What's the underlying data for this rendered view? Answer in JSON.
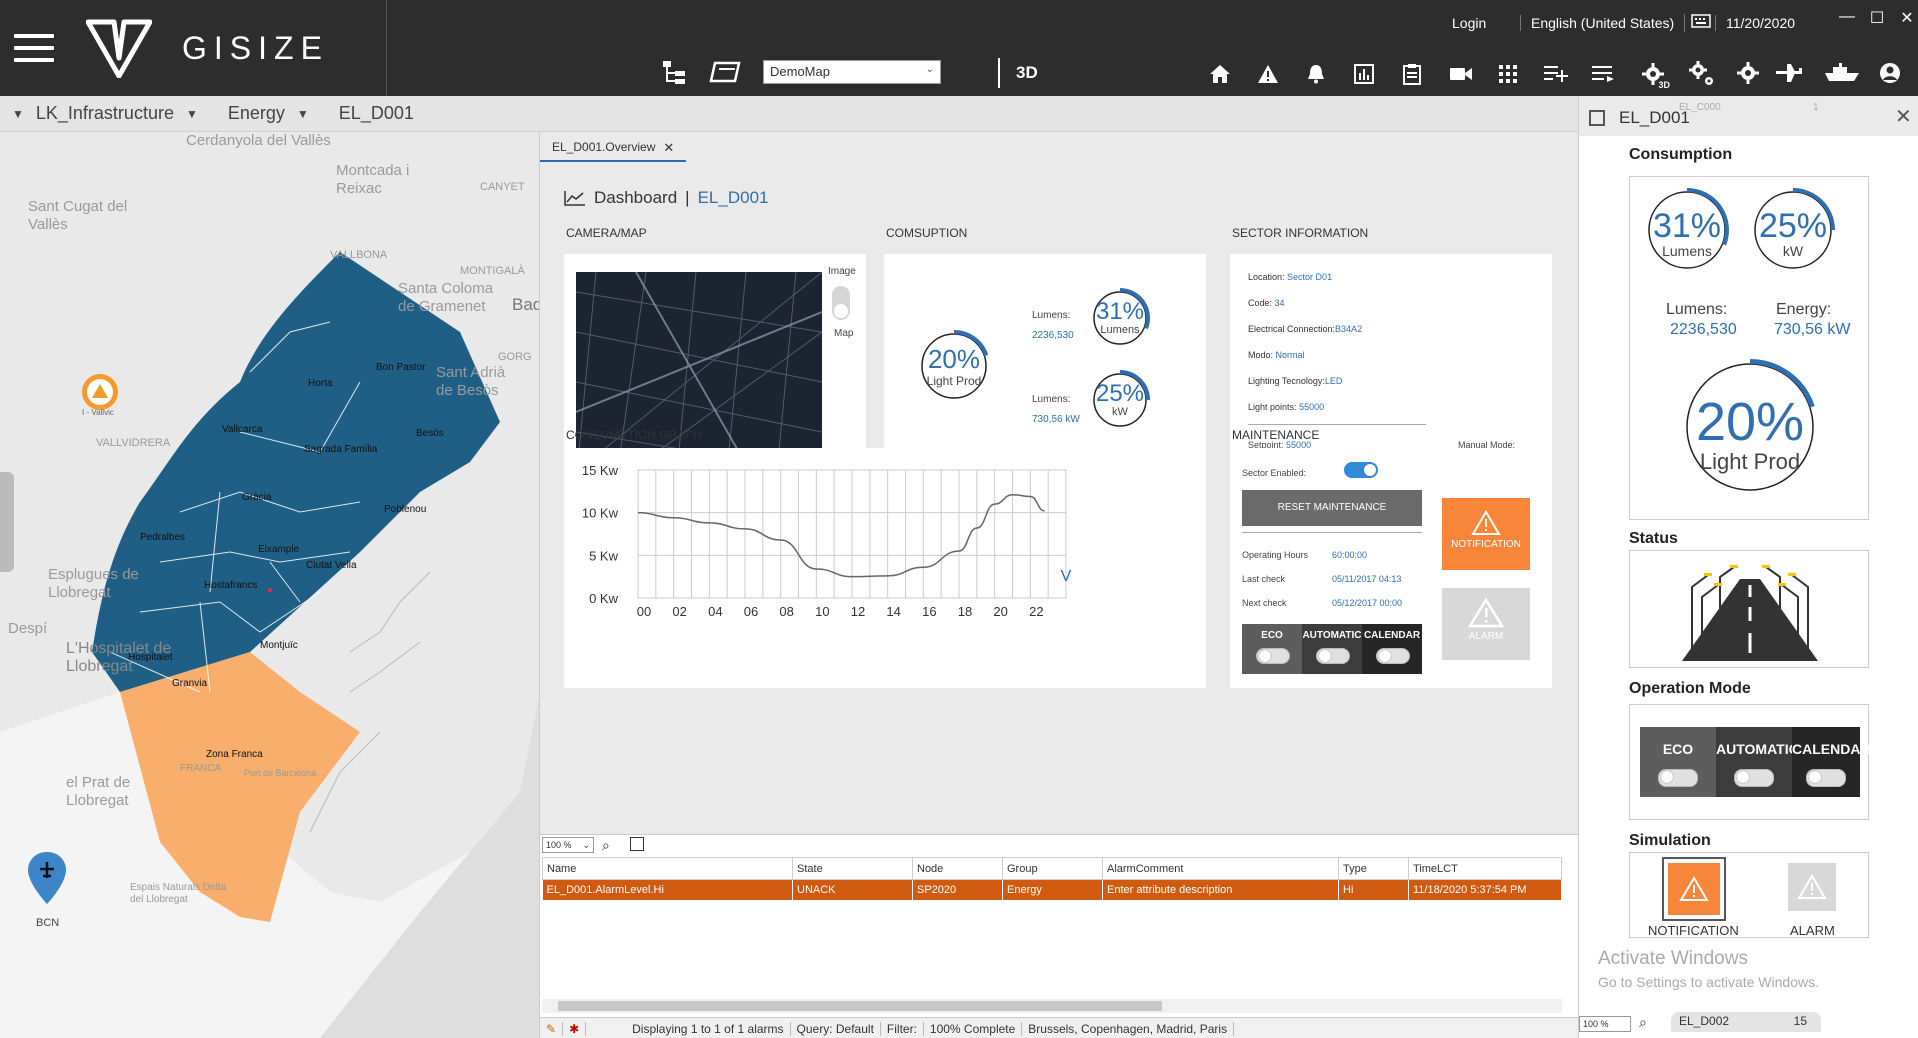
{
  "brand": "GISIZE",
  "topbar": {
    "map_select": "DemoMap",
    "btn_3d": "3D",
    "login": "Login",
    "language": "English (United States)",
    "date": "11/20/2020",
    "icon_3d_badge": "3D"
  },
  "breadcrumb": [
    "LK_Infrastructure",
    "Energy",
    "EL_D001"
  ],
  "map": {
    "labels": [
      "Cerdanyola del Vallès",
      "Montcada i Reixac",
      "CANYET",
      "Sant Cugat del Vallès",
      "VALLBONA",
      "MONTIGALÀ",
      "Santa Coloma de Gramenet",
      "Bad",
      "Sant Adrià de Besòs",
      "GORG",
      "Esplugues de Llobregat",
      "Despí",
      "L'Hospitalet de Llobregat",
      "el Prat de Llobregat",
      "Espais Naturals Delta del Llobregat",
      "VALLVIDRERA",
      "Zona Franca",
      "Port de Barcelona",
      "FRANCA",
      "BCN",
      "Vallvidrera"
    ],
    "districts": [
      "Horta",
      "Bon Pastor",
      "Vallcarca",
      "Sagrada Família",
      "Besòs",
      "Gràcia",
      "Poblenou",
      "Pedralbes",
      "Eixample",
      "Ciutat Vella",
      "Hostafrancs",
      "Montjuïc",
      "Hospitalet",
      "Granvia",
      "Zona Franca"
    ],
    "marker_label": "I - Vallvic",
    "district_color": "#1f5f86",
    "port_color": "#f9ae6c"
  },
  "tab": {
    "label": "EL_D001.Overview",
    "close": "✕"
  },
  "dashboard": {
    "title": "Dashboard",
    "subtitle": "EL_D001",
    "sections": {
      "camera": "CAMERA/MAP",
      "consumption": "COMSUPTION",
      "sector": "SECTOR INFORMATION",
      "graph": "CONSUMPTION GRAPH",
      "maintenance": "MAINTENANCE"
    },
    "camera": {
      "image_label": "Image",
      "map_label": "Map"
    },
    "gauges": {
      "main": {
        "value": "20%",
        "label": "Light Prod",
        "pct": 20
      },
      "lumens": {
        "value": "31%",
        "label": "Lumens",
        "pct": 31,
        "caption": "Lumens:",
        "reading": "2236,530"
      },
      "kw": {
        "value": "25%",
        "label": "kW",
        "pct": 25,
        "caption": "Lumens:",
        "reading": "730,56 kW"
      }
    },
    "sector": {
      "rows": [
        {
          "label": "Location:",
          "value": "Sector D01"
        },
        {
          "label": "Code:",
          "value": "34"
        },
        {
          "label": "Electrical Connection:",
          "value": "B34A2"
        },
        {
          "label": "Modo:",
          "value": "Normal"
        },
        {
          "label": "Lighting Tecnology:",
          "value": "LED"
        },
        {
          "label": "Light points:",
          "value": "55000"
        }
      ],
      "setpoint_label": "Setpoint:",
      "setpoint_value": "55000",
      "manual_mode_label": "Manual Mode:"
    },
    "maintenance": {
      "sector_enabled": "Sector Enabled:",
      "reset": "RESET MAINTENANCE",
      "rows": [
        {
          "label": "Operating Hours",
          "value": "60:00:00"
        },
        {
          "label": "Last check",
          "value": "05/11/2017 04:13"
        },
        {
          "label": "Next check",
          "value": "05/12/2017 00:00"
        }
      ],
      "modes": [
        "ECO",
        "AUTOMATIC",
        "CALENDAR"
      ],
      "notification": "NOTIFICATION",
      "alarm": "ALARM"
    }
  },
  "chart_data": {
    "type": "line",
    "title": "",
    "xlabel": "",
    "ylabel": "",
    "x": [
      0,
      2,
      4,
      6,
      8,
      10,
      12,
      14,
      16,
      18,
      19,
      20,
      21,
      22,
      22.8
    ],
    "y": [
      10,
      9.4,
      8.8,
      8.1,
      6.8,
      3.4,
      2.5,
      2.6,
      3.6,
      5.5,
      8.2,
      11,
      12.1,
      11.9,
      10.2
    ],
    "x_ticks": [
      "00",
      "02",
      "04",
      "06",
      "08",
      "10",
      "12",
      "14",
      "16",
      "18",
      "20",
      "22"
    ],
    "y_ticks": [
      "15 Kw",
      "10 Kw",
      "5 Kw",
      "0 Kw"
    ],
    "xlim": [
      0,
      24
    ],
    "ylim": [
      0,
      15
    ],
    "grid": true,
    "line_color": "#666666",
    "end_marker": "V"
  },
  "alarm_grid": {
    "zoom": "100 %",
    "columns": [
      "Name",
      "State",
      "Node",
      "Group",
      "AlarmComment",
      "Type",
      "TimeLCT"
    ],
    "rows": [
      [
        "EL_D001.AlarmLevel.Hi",
        "UNACK",
        "SP2020",
        "Energy",
        "Enter attribute description",
        "Hi",
        "11/18/2020 5:37:54 PM"
      ]
    ],
    "status": {
      "displaying": "Displaying 1 to 1 of 1 alarms",
      "query": "Query: Default",
      "filter": "Filter:",
      "complete": "100% Complete",
      "timezone": "Brussels, Copenhagen, Madrid, Paris"
    }
  },
  "right_panel": {
    "title": "EL_D001",
    "ghost_top": {
      "name": "EL_C000",
      "count": "1"
    },
    "ghost_bottom": {
      "name": "EL_D002",
      "count": "15"
    },
    "zoom": "100 %",
    "consumption": "Consumption",
    "gauge_lumens": {
      "value": "31%",
      "label": "Lumens",
      "pct": 31
    },
    "gauge_kw": {
      "value": "25%",
      "label": "kW",
      "pct": 25
    },
    "lumens_caption": "Lumens:",
    "lumens_value": "2236,530",
    "energy_caption": "Energy:",
    "energy_value": "730,56 kW",
    "gauge_main": {
      "value": "20%",
      "label": "Light Prod",
      "pct": 20
    },
    "status": "Status",
    "operation_mode": "Operation Mode",
    "modes": [
      "ECO",
      "AUTOMATIC",
      "CALENDAR"
    ],
    "simulation": "Simulation",
    "notification": "NOTIFICATION",
    "alarm": "ALARM"
  },
  "watermark": {
    "line1": "Activate Windows",
    "line2": "Go to Settings to activate Windows."
  },
  "colors": {
    "accent": "#2f6fb0",
    "alarm_row": "#cf5a10",
    "notification": "#f7863b",
    "topbar": "#2d2d2d"
  }
}
